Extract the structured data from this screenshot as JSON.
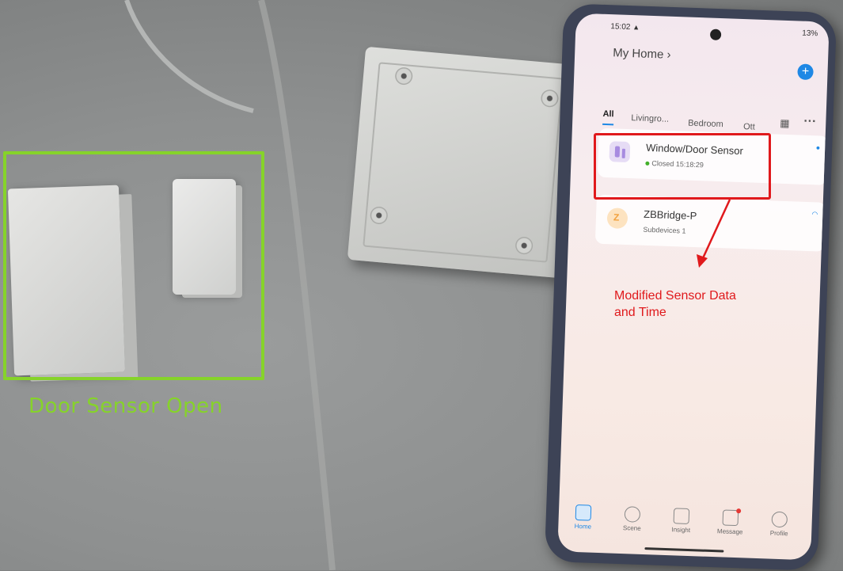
{
  "photo": {
    "annotation_left": "Door Sensor Open",
    "annotation_right_line1": "Modified Sensor Data",
    "annotation_right_line2": "and Time",
    "colors": {
      "green": "#86d32a",
      "red": "#e0191c"
    }
  },
  "phone": {
    "status": {
      "time": "15:02",
      "warning_icon": "▲",
      "battery": "13%"
    },
    "header": {
      "title": "My Home",
      "chevron": "›",
      "add_icon": "+"
    },
    "tabs": [
      {
        "label": "All"
      },
      {
        "label": "Livingro..."
      },
      {
        "label": "Bedroom"
      },
      {
        "label": "Ott"
      }
    ],
    "devices": [
      {
        "name": "Window/Door Sensor",
        "status": "Closed 15:18:29"
      },
      {
        "name": "ZBBridge-P",
        "status": "Subdevices 1"
      }
    ],
    "nav": [
      {
        "label": "Home"
      },
      {
        "label": "Scene"
      },
      {
        "label": "Insight"
      },
      {
        "label": "Message"
      },
      {
        "label": "Profile"
      }
    ]
  }
}
